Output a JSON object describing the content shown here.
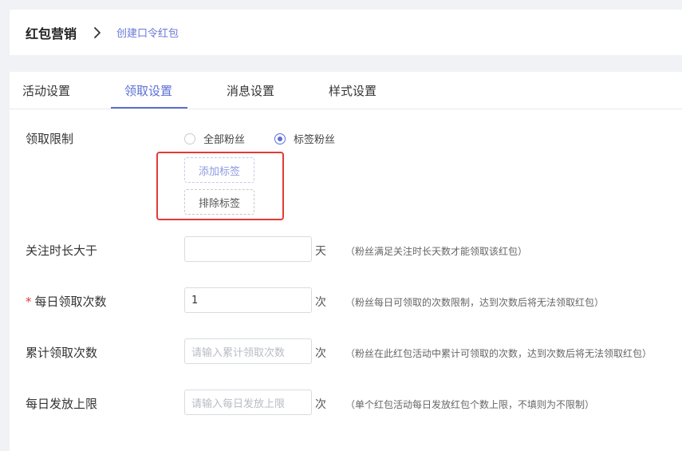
{
  "breadcrumb": {
    "root": "红包营销",
    "current": "创建口令红包"
  },
  "tabs": [
    {
      "label": "活动设置",
      "active": false
    },
    {
      "label": "领取设置",
      "active": true
    },
    {
      "label": "消息设置",
      "active": false
    },
    {
      "label": "样式设置",
      "active": false
    }
  ],
  "form": {
    "receive_limit": {
      "label": "领取限制",
      "options": [
        {
          "label": "全部粉丝",
          "checked": false
        },
        {
          "label": "标签粉丝",
          "checked": true
        }
      ],
      "add_tag_label": "添加标签",
      "exclude_tag_label": "排除标签"
    },
    "follow_duration": {
      "label": "关注时长大于",
      "value": "",
      "placeholder": "",
      "unit": "天",
      "hint": "（粉丝满足关注时长天数才能领取该红包）"
    },
    "daily_receive": {
      "required": true,
      "required_mark": "*",
      "label": "每日领取次数",
      "value": "1",
      "unit": "次",
      "hint": "（粉丝每日可领取的次数限制，达到次数后将无法领取红包）"
    },
    "total_receive": {
      "label": "累计领取次数",
      "value": "",
      "placeholder": "请输入累计领取次数",
      "unit": "次",
      "hint": "（粉丝在此红包活动中累计可领取的次数，达到次数后将无法领取红包）"
    },
    "daily_issue_limit": {
      "label": "每日发放上限",
      "value": "",
      "placeholder": "请输入每日发放上限",
      "unit": "次",
      "hint": "（单个红包活动每日发放红包个数上限，不填则为不限制）"
    }
  },
  "colors": {
    "accent": "#5b6fd6",
    "highlight_border": "#e53935",
    "required": "#e4393c"
  }
}
